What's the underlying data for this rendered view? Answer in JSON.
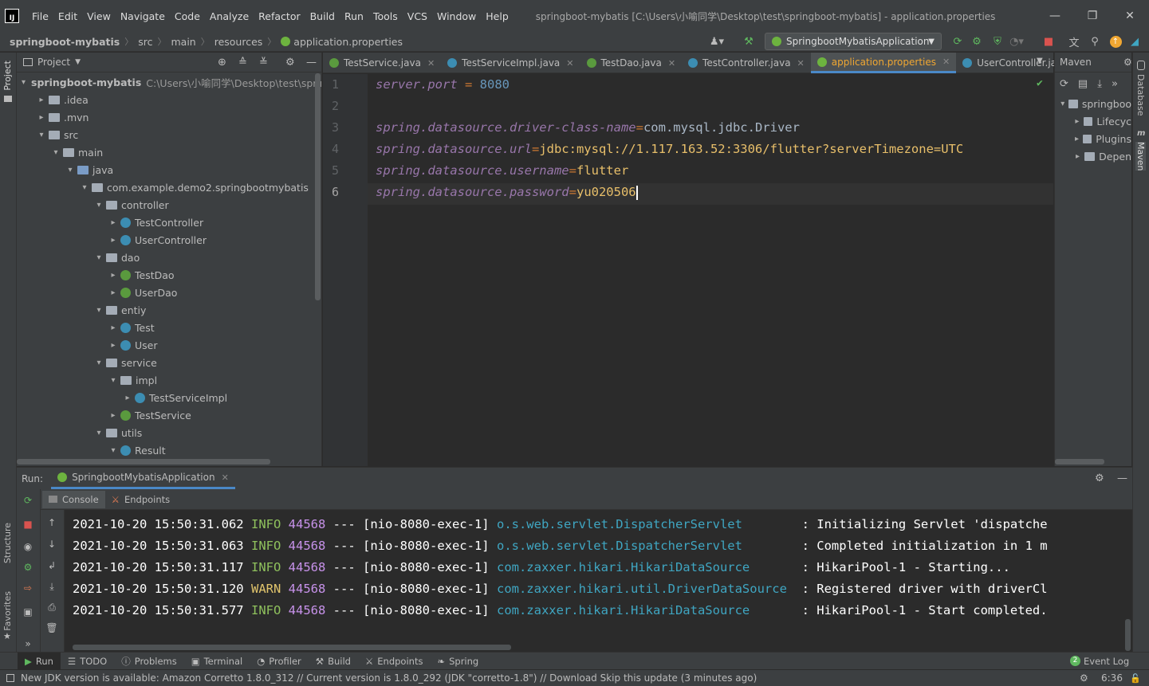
{
  "window": {
    "title": "springboot-mybatis [C:\\Users\\小喻同学\\Desktop\\test\\springboot-mybatis] - application.properties",
    "logo": "IJ"
  },
  "menu": [
    "File",
    "Edit",
    "View",
    "Navigate",
    "Code",
    "Analyze",
    "Refactor",
    "Build",
    "Run",
    "Tools",
    "VCS",
    "Window",
    "Help"
  ],
  "breadcrumb": [
    "springboot-mybatis",
    "src",
    "main",
    "resources",
    "application.properties"
  ],
  "run_config": "SpringbootMybatisApplication",
  "project_pane": {
    "title": "Project",
    "tree": [
      {
        "level": 0,
        "arrow": "▾",
        "type": "folder",
        "label": "springboot-mybatis",
        "path": "C:\\Users\\小喻同学\\Desktop\\test\\sprin",
        "bold": true
      },
      {
        "level": 1,
        "arrow": "▸",
        "type": "folder",
        "label": ".idea"
      },
      {
        "level": 1,
        "arrow": "▸",
        "type": "folder",
        "label": ".mvn"
      },
      {
        "level": 1,
        "arrow": "▾",
        "type": "folder",
        "label": "src"
      },
      {
        "level": 2,
        "arrow": "▾",
        "type": "folder",
        "label": "main"
      },
      {
        "level": 3,
        "arrow": "▾",
        "type": "folder-blue",
        "label": "java"
      },
      {
        "level": 4,
        "arrow": "▾",
        "type": "folder",
        "label": "com.example.demo2.springbootmybatis"
      },
      {
        "level": 5,
        "arrow": "▾",
        "type": "folder",
        "label": "controller"
      },
      {
        "level": 6,
        "arrow": "▸",
        "type": "class",
        "label": "TestController"
      },
      {
        "level": 6,
        "arrow": "▸",
        "type": "class",
        "label": "UserController"
      },
      {
        "level": 5,
        "arrow": "▾",
        "type": "folder",
        "label": "dao"
      },
      {
        "level": 6,
        "arrow": "▸",
        "type": "interface",
        "label": "TestDao"
      },
      {
        "level": 6,
        "arrow": "▸",
        "type": "interface",
        "label": "UserDao"
      },
      {
        "level": 5,
        "arrow": "▾",
        "type": "folder",
        "label": "entiy"
      },
      {
        "level": 6,
        "arrow": "▸",
        "type": "class",
        "label": "Test"
      },
      {
        "level": 6,
        "arrow": "▸",
        "type": "class",
        "label": "User"
      },
      {
        "level": 5,
        "arrow": "▾",
        "type": "folder",
        "label": "service"
      },
      {
        "level": 6,
        "arrow": "▾",
        "type": "folder",
        "label": "impl"
      },
      {
        "level": 7,
        "arrow": "▸",
        "type": "class",
        "label": "TestServiceImpl"
      },
      {
        "level": 6,
        "arrow": "▸",
        "type": "interface",
        "label": "TestService"
      },
      {
        "level": 5,
        "arrow": "▾",
        "type": "folder",
        "label": "utils"
      },
      {
        "level": 6,
        "arrow": "▾",
        "type": "class",
        "label": "Result"
      }
    ]
  },
  "editor_tabs": [
    {
      "label": "TestService.java",
      "icon": "interface",
      "active": false
    },
    {
      "label": "TestServiceImpl.java",
      "icon": "class",
      "active": false
    },
    {
      "label": "TestDao.java",
      "icon": "interface",
      "active": false
    },
    {
      "label": "TestController.java",
      "icon": "class",
      "active": false
    },
    {
      "label": "application.properties",
      "icon": "spring",
      "active": true
    },
    {
      "label": "UserController.ja",
      "icon": "class",
      "active": false
    }
  ],
  "editor_lines": [
    {
      "n": "1",
      "key": "server.port",
      "sep": " = ",
      "value": "8080",
      "type": "num"
    },
    {
      "n": "2",
      "key": "",
      "sep": "",
      "value": "",
      "type": "empty"
    },
    {
      "n": "3",
      "key": "spring.datasource.driver-class-name",
      "sep": "=",
      "value": "com.mysql.jdbc.Driver",
      "type": "text"
    },
    {
      "n": "4",
      "key": "spring.datasource.url",
      "sep": "=",
      "value": "jdbc:mysql://1.117.163.52:3306/flutter?serverTimezone=UTC",
      "type": "str"
    },
    {
      "n": "5",
      "key": "spring.datasource.username",
      "sep": "=",
      "value": "flutter",
      "type": "str"
    },
    {
      "n": "6",
      "key": "spring.datasource.password",
      "sep": "=",
      "value": "yu020506",
      "type": "str"
    }
  ],
  "maven": {
    "title": "Maven",
    "items": [
      {
        "arrow": "▾",
        "label": "springboo"
      },
      {
        "arrow": "▸",
        "label": "Lifecyc"
      },
      {
        "arrow": "▸",
        "label": "Plugins"
      },
      {
        "arrow": "▸",
        "label": "Depen"
      }
    ]
  },
  "right_stripe": [
    "Database",
    "Maven"
  ],
  "left_stripe": [
    "Project",
    "Structure",
    "Favorites"
  ],
  "run_window": {
    "label": "Run:",
    "tab": "SpringbootMybatisApplication",
    "subtabs": [
      "Console",
      "Endpoints"
    ],
    "log": [
      {
        "ts": "2021-10-20 15:50:31.062",
        "level": "INFO",
        "pid": "44568",
        "thread": "--- [nio-8080-exec-1]",
        "logger": "o.s.web.servlet.DispatcherServlet       ",
        "msg": ": Initializing Servlet 'dispatche"
      },
      {
        "ts": "2021-10-20 15:50:31.063",
        "level": "INFO",
        "pid": "44568",
        "thread": "--- [nio-8080-exec-1]",
        "logger": "o.s.web.servlet.DispatcherServlet       ",
        "msg": ": Completed initialization in 1 m"
      },
      {
        "ts": "2021-10-20 15:50:31.117",
        "level": "INFO",
        "pid": "44568",
        "thread": "--- [nio-8080-exec-1]",
        "logger": "com.zaxxer.hikari.HikariDataSource      ",
        "msg": ": HikariPool-1 - Starting..."
      },
      {
        "ts": "2021-10-20 15:50:31.120",
        "level": "WARN",
        "pid": "44568",
        "thread": "--- [nio-8080-exec-1]",
        "logger": "com.zaxxer.hikari.util.DriverDataSource ",
        "msg": ": Registered driver with driverCl"
      },
      {
        "ts": "2021-10-20 15:50:31.577",
        "level": "INFO",
        "pid": "44568",
        "thread": "--- [nio-8080-exec-1]",
        "logger": "com.zaxxer.hikari.HikariDataSource      ",
        "msg": ": HikariPool-1 - Start completed."
      }
    ]
  },
  "bottom_tools": [
    "Run",
    "TODO",
    "Problems",
    "Terminal",
    "Profiler",
    "Build",
    "Endpoints",
    "Spring"
  ],
  "event_log": {
    "count": "2",
    "label": "Event Log"
  },
  "status": {
    "message": "New JDK version is available: Amazon Corretto 1.8.0_312 // Current version is 1.8.0_292 (JDK \"corretto-1.8\") // Download   Skip this update (3 minutes ago)",
    "position": "6:36"
  },
  "colors": {
    "accent": "#4a88c7",
    "active_tab_text": "#f0a732",
    "keyword": "#9876aa",
    "string": "#e8bf6a",
    "number": "#6897bb"
  }
}
